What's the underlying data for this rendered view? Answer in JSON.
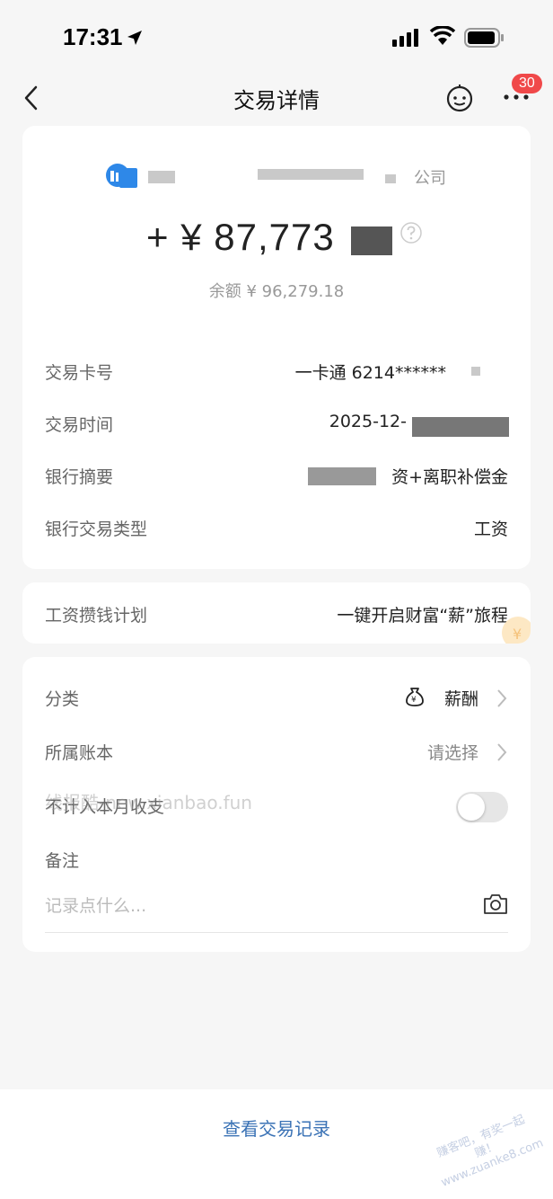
{
  "status_bar": {
    "time": "17:31"
  },
  "nav": {
    "title": "交易详情",
    "badge_count": "30"
  },
  "merchant": {
    "suffix": "公司"
  },
  "amount": {
    "text": "+ ¥ 87,773"
  },
  "balance": {
    "text": "余额 ¥ 96,279.18"
  },
  "details": [
    {
      "label": "交易卡号",
      "value": "一卡通 6214******"
    },
    {
      "label": "交易时间",
      "value": "2025-12-"
    },
    {
      "label": "银行摘要",
      "value": "资+离职补偿金"
    },
    {
      "label": "银行交易类型",
      "value": "工资"
    }
  ],
  "plan": {
    "label": "工资攒钱计划",
    "value": "一键开启财富“薪”旅程"
  },
  "settings": {
    "category_label": "分类",
    "category_value": "薪酬",
    "ledger_label": "所属账本",
    "ledger_value": "请选择",
    "exclude_label": "不计入本月收支",
    "exclude_on": false,
    "note_label": "备注",
    "note_placeholder": "记录点什么..."
  },
  "watermark": "线报酷-new.xianbao.fun",
  "corner_watermark": "赚客吧，有奖一起赚！ www.zuanke8.com",
  "bottom": {
    "link": "查看交易记录"
  },
  "colors": {
    "accent_link": "#3a72b5",
    "badge": "#f0494a",
    "merchant_logo": "#2e88e8"
  }
}
